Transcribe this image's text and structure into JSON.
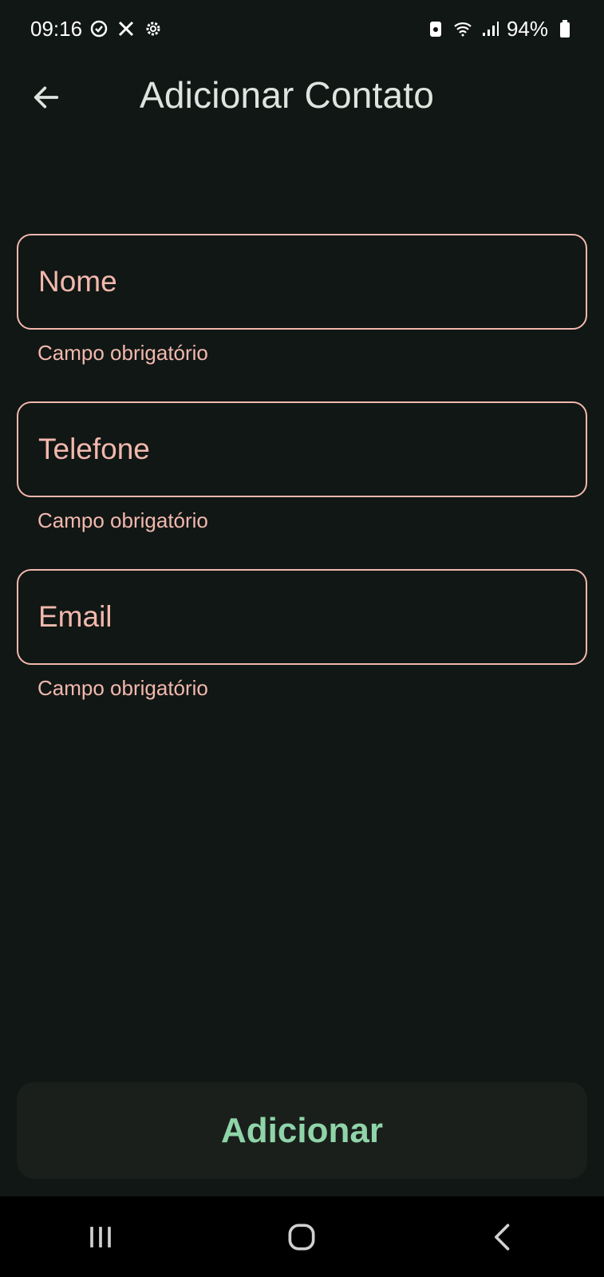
{
  "status_bar": {
    "time": "09:16",
    "battery": "94%",
    "left_icons": [
      "notification-icon",
      "tools-icon",
      "settings-gear-icon"
    ],
    "right_icons": [
      "battery-saver-icon",
      "wifi-icon",
      "signal-icon",
      "battery-icon"
    ]
  },
  "app_bar": {
    "back_icon": "arrow-left-icon",
    "title": "Adicionar Contato"
  },
  "form": {
    "fields": [
      {
        "label": "Nome",
        "helper": "Campo obrigatório"
      },
      {
        "label": "Telefone",
        "helper": "Campo obrigatório"
      },
      {
        "label": "Email",
        "helper": "Campo obrigatório"
      }
    ]
  },
  "actions": {
    "submit_label": "Adicionar"
  },
  "nav_bar": {
    "icons": [
      "recent-apps-icon",
      "home-icon",
      "back-icon"
    ]
  },
  "colors": {
    "background": "#111714",
    "error_accent": "#f2b8ae",
    "button_text": "#8fd4a8",
    "button_bg": "#1a1f1c"
  }
}
